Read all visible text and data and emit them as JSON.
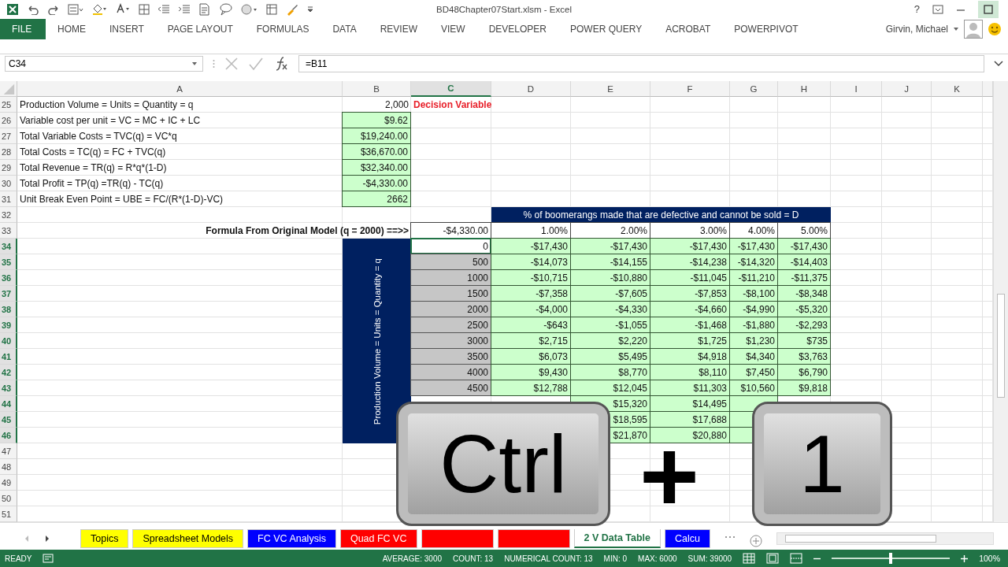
{
  "window": {
    "title": "BD48Chapter07Start.xlsm - Excel",
    "help": "?"
  },
  "ribbon_tabs": [
    {
      "label": "FILE",
      "kind": "file",
      "selected": false
    },
    {
      "label": "HOME",
      "kind": "tab",
      "selected": false
    },
    {
      "label": "INSERT",
      "kind": "tab",
      "selected": false
    },
    {
      "label": "PAGE LAYOUT",
      "kind": "tab",
      "selected": false
    },
    {
      "label": "FORMULAS",
      "kind": "tab",
      "selected": false
    },
    {
      "label": "DATA",
      "kind": "tab",
      "selected": false
    },
    {
      "label": "REVIEW",
      "kind": "tab",
      "selected": false
    },
    {
      "label": "VIEW",
      "kind": "tab",
      "selected": false
    },
    {
      "label": "DEVELOPER",
      "kind": "tab",
      "selected": false
    },
    {
      "label": "POWER QUERY",
      "kind": "tab",
      "selected": false
    },
    {
      "label": "ACROBAT",
      "kind": "tab",
      "selected": false
    },
    {
      "label": "POWERPIVOT",
      "kind": "tab",
      "selected": false
    }
  ],
  "user": {
    "name": "Girvin, Michael"
  },
  "formula_bar": {
    "name_box": "C34",
    "formula": "=B11"
  },
  "sheet": {
    "columns": [
      {
        "letter": "A",
        "selected": false
      },
      {
        "letter": "B",
        "selected": false
      },
      {
        "letter": "C",
        "selected": true
      },
      {
        "letter": "D",
        "selected": false
      },
      {
        "letter": "E",
        "selected": false
      },
      {
        "letter": "F",
        "selected": false
      },
      {
        "letter": "G",
        "selected": false
      },
      {
        "letter": "H",
        "selected": false
      },
      {
        "letter": "I",
        "selected": false
      },
      {
        "letter": "J",
        "selected": false
      },
      {
        "letter": "K",
        "selected": false
      }
    ],
    "rows": [
      {
        "number": "25",
        "selected": false
      },
      {
        "number": "26",
        "selected": false
      },
      {
        "number": "27",
        "selected": false
      },
      {
        "number": "28",
        "selected": false
      },
      {
        "number": "29",
        "selected": false
      },
      {
        "number": "30",
        "selected": false
      },
      {
        "number": "31",
        "selected": false
      },
      {
        "number": "32",
        "selected": false
      },
      {
        "number": "33",
        "selected": false
      },
      {
        "number": "34",
        "selected": true
      },
      {
        "number": "35",
        "selected": true
      },
      {
        "number": "36",
        "selected": true
      },
      {
        "number": "37",
        "selected": true
      },
      {
        "number": "38",
        "selected": true
      },
      {
        "number": "39",
        "selected": true
      },
      {
        "number": "40",
        "selected": true
      },
      {
        "number": "41",
        "selected": true
      },
      {
        "number": "42",
        "selected": true
      },
      {
        "number": "43",
        "selected": true
      },
      {
        "number": "44",
        "selected": true
      },
      {
        "number": "45",
        "selected": true
      },
      {
        "number": "46",
        "selected": true
      },
      {
        "number": "47",
        "selected": false
      },
      {
        "number": "48",
        "selected": false
      },
      {
        "number": "49",
        "selected": false
      },
      {
        "number": "50",
        "selected": false
      },
      {
        "number": "51",
        "selected": false
      }
    ],
    "model": [
      {
        "label": "Production Volume = Units = Quantity = q",
        "value": "2,000",
        "kind": "plain",
        "note": "Decision Variable"
      },
      {
        "label": "Variable cost per unit = VC = MC + IC + LC",
        "value": "$9.62",
        "kind": "green"
      },
      {
        "label": "Total Variable Costs = TVC(q) = VC*q",
        "value": "$19,240.00",
        "kind": "green"
      },
      {
        "label": "Total Costs = TC(q) = FC + TVC(q)",
        "value": "$36,670.00",
        "kind": "green"
      },
      {
        "label": "Total Revenue = TR(q) = R*q*(1-D)",
        "value": "$32,340.00",
        "kind": "green"
      },
      {
        "label": "Total Profit = TP(q) =TR(q) - TC(q)",
        "value": "-$4,330.00",
        "kind": "green"
      },
      {
        "label": "Unit Break Even Point = UBE = FC/(R*(1-D)-VC)",
        "value": "2662",
        "kind": "green"
      }
    ],
    "data_table": {
      "banner": "% of boomerangs made that are defective and cannot be sold = D",
      "caption": "Formula From Original Model (q = 2000) ==>>",
      "formula_value": "-$4,330.00",
      "rates": [
        "1.00%",
        "2.00%",
        "3.00%",
        "4.00%",
        "5.00%"
      ],
      "side_label": "Production Volume = Units = Quantity = q",
      "rows": [
        {
          "input": "0",
          "selected": true,
          "kind": "full",
          "values": [
            "-$17,430",
            "-$17,430",
            "-$17,430",
            "-$17,430",
            "-$17,430"
          ]
        },
        {
          "input": "500",
          "selected": true,
          "kind": "full",
          "values": [
            "-$14,073",
            "-$14,155",
            "-$14,238",
            "-$14,320",
            "-$14,403"
          ]
        },
        {
          "input": "1000",
          "selected": true,
          "kind": "full",
          "values": [
            "-$10,715",
            "-$10,880",
            "-$11,045",
            "-$11,210",
            "-$11,375"
          ]
        },
        {
          "input": "1500",
          "selected": true,
          "kind": "full",
          "values": [
            "-$7,358",
            "-$7,605",
            "-$7,853",
            "-$8,100",
            "-$8,348"
          ]
        },
        {
          "input": "2000",
          "selected": true,
          "kind": "full",
          "values": [
            "-$4,000",
            "-$4,330",
            "-$4,660",
            "-$4,990",
            "-$5,320"
          ]
        },
        {
          "input": "2500",
          "selected": true,
          "kind": "full",
          "values": [
            "-$643",
            "-$1,055",
            "-$1,468",
            "-$1,880",
            "-$2,293"
          ]
        },
        {
          "input": "3000",
          "selected": true,
          "kind": "full",
          "values": [
            "$2,715",
            "$2,220",
            "$1,725",
            "$1,230",
            "$735"
          ]
        },
        {
          "input": "3500",
          "selected": true,
          "kind": "full",
          "values": [
            "$6,073",
            "$5,495",
            "$4,918",
            "$4,340",
            "$3,763"
          ]
        },
        {
          "input": "4000",
          "selected": true,
          "kind": "full",
          "values": [
            "$9,430",
            "$8,770",
            "$8,110",
            "$7,450",
            "$6,790"
          ]
        },
        {
          "input": "4500",
          "selected": true,
          "kind": "full",
          "values": [
            "$12,788",
            "$12,045",
            "$11,303",
            "$10,560",
            "$9,818"
          ]
        },
        {
          "kind": "partial",
          "values": [
            "$15,320",
            "$14,495"
          ]
        },
        {
          "kind": "partial",
          "values": [
            "$18,595",
            "$17,688"
          ]
        },
        {
          "kind": "partial",
          "values": [
            "$21,870",
            "$20,880"
          ]
        }
      ]
    }
  },
  "key_overlay": {
    "keys": [
      "Ctrl",
      "1"
    ],
    "joiner": "+"
  },
  "sheet_tabs": [
    {
      "label": "Topics",
      "color": "#ffff00",
      "selected": false
    },
    {
      "label": "Spreadsheet Models",
      "color": "#ffff00",
      "selected": false
    },
    {
      "label": "FC VC Analysis",
      "color": "#0000ff",
      "selected": false
    },
    {
      "label": "Quad FC VC",
      "color": "#ff0000",
      "selected": false
    },
    {
      "color": "#ff0000",
      "selected": false
    },
    {
      "color": "#ff0000",
      "selected": false
    },
    {
      "label": "2 V Data Table",
      "color": "#ffffff",
      "selected": true
    },
    {
      "label": "Calcu",
      "color": "#0000ff",
      "selected": false
    }
  ],
  "status_bar": {
    "mode": "READY",
    "stats": [
      "AVERAGE: 3000",
      "COUNT: 13",
      "NUMERICAL COUNT: 13",
      "MIN: 0",
      "MAX: 6000",
      "SUM: 39000"
    ],
    "zoom": {
      "level": 0.5,
      "reading": "100%"
    }
  }
}
